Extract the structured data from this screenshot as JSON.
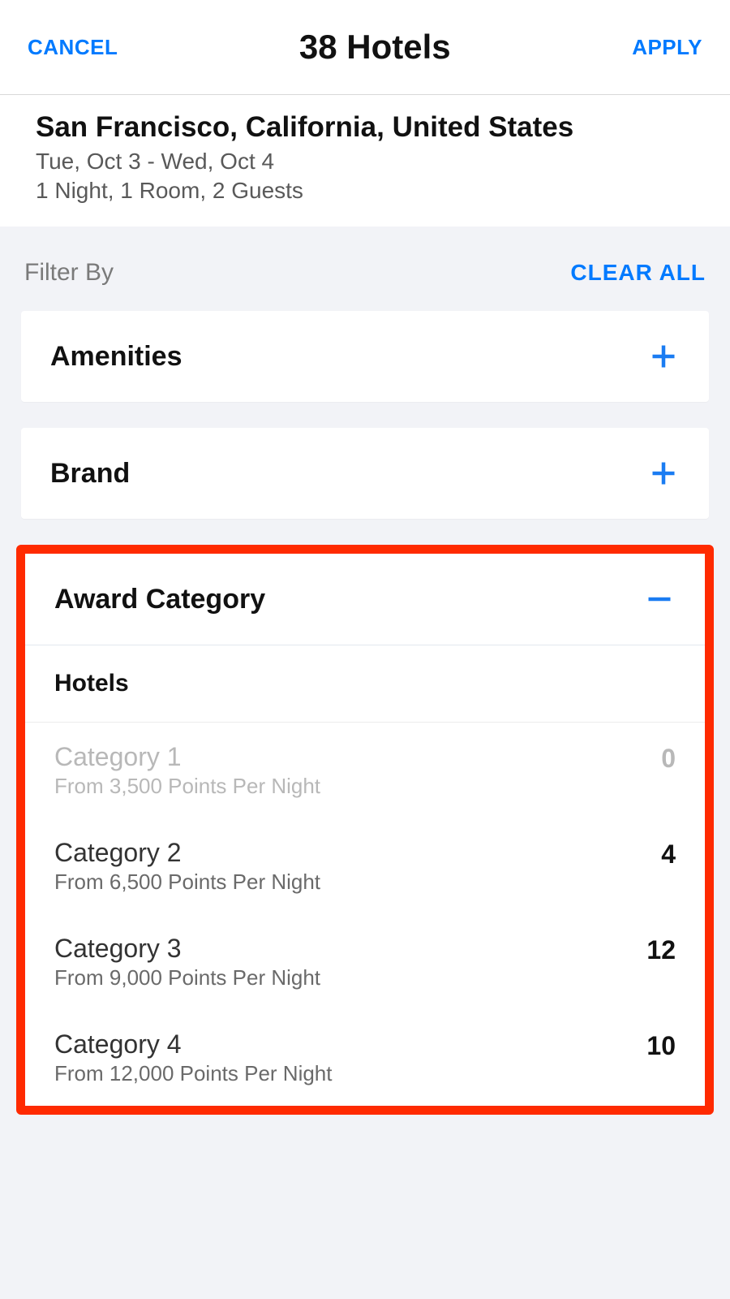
{
  "header": {
    "cancel": "CANCEL",
    "title": "38 Hotels",
    "apply": "APPLY"
  },
  "search": {
    "location": "San Francisco, California, United States",
    "dates": "Tue, Oct 3 - Wed, Oct 4",
    "details": "1 Night, 1 Room, 2 Guests"
  },
  "filter_section": {
    "label": "Filter By",
    "clear": "CLEAR ALL"
  },
  "filters": {
    "amenities": {
      "title": "Amenities"
    },
    "brand": {
      "title": "Brand"
    },
    "award": {
      "title": "Award Category",
      "subhead": "Hotels",
      "categories": [
        {
          "name": "Category 1",
          "sub": "From 3,500 Points Per Night",
          "count": "0",
          "disabled": true
        },
        {
          "name": "Category 2",
          "sub": "From 6,500 Points Per Night",
          "count": "4",
          "disabled": false
        },
        {
          "name": "Category 3",
          "sub": "From 9,000 Points Per Night",
          "count": "12",
          "disabled": false
        },
        {
          "name": "Category 4",
          "sub": "From 12,000 Points Per Night",
          "count": "10",
          "disabled": false
        }
      ]
    }
  }
}
